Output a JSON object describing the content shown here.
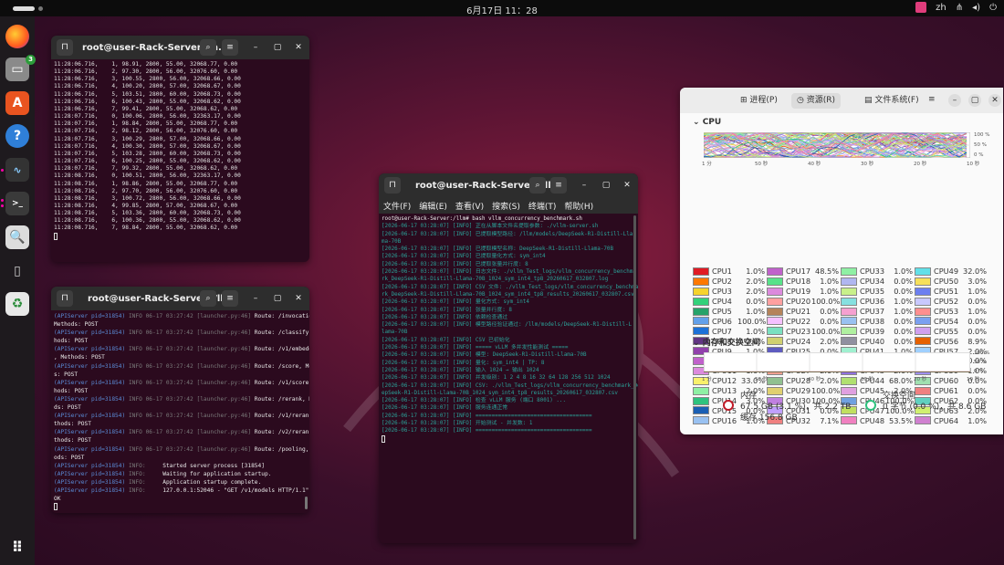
{
  "topbar": {
    "clock": "6月17日  11：28",
    "lang": "zh"
  },
  "dock": {
    "items": [
      {
        "name": "firefox"
      },
      {
        "name": "files",
        "badge": "3"
      },
      {
        "name": "app-center"
      },
      {
        "name": "help"
      },
      {
        "name": "system-monitor"
      },
      {
        "name": "terminal"
      },
      {
        "name": "image-viewer"
      },
      {
        "name": "usb-drive"
      },
      {
        "name": "trash"
      },
      {
        "name": "show-apps"
      }
    ]
  },
  "win1": {
    "title": "root@user-Rack-Server: /h...",
    "lines": [
      "11:28:06.716,    1, 98.91, 2800, 55.00, 32068.77, 0.00",
      "11:28:06.716,    2, 97.30, 2800, 56.00, 32076.60, 0.00",
      "11:28:06.716,    3, 100.55, 2800, 56.00, 32068.66, 0.00",
      "11:28:06.716,    4, 100.20, 2800, 57.00, 32068.67, 0.00",
      "11:28:06.716,    5, 103.51, 2800, 60.00, 32068.73, 0.00",
      "11:28:06.716,    6, 100.43, 2800, 55.00, 32068.62, 0.00",
      "11:28:06.716,    7, 99.41, 2800, 55.00, 32068.62, 0.00",
      "11:28:07.716,    0, 100.06, 2800, 56.00, 32363.17, 0.00",
      "11:28:07.716,    1, 98.84, 2800, 55.00, 32068.77, 0.00",
      "11:28:07.716,    2, 98.12, 2800, 56.00, 32076.60, 0.00",
      "11:28:07.716,    3, 100.29, 2800, 57.00, 32068.66, 0.00",
      "11:28:07.716,    4, 100.30, 2800, 57.00, 32068.67, 0.00",
      "11:28:07.716,    5, 103.28, 2800, 60.00, 32068.73, 0.00",
      "11:28:07.716,    6, 100.25, 2800, 55.00, 32068.62, 0.00",
      "11:28:07.716,    7, 99.32, 2800, 55.00, 32068.62, 0.00",
      "11:28:08.716,    0, 100.51, 2800, 56.00, 32363.17, 0.00",
      "11:28:08.716,    1, 98.86, 2800, 55.00, 32068.77, 0.00",
      "11:28:08.716,    2, 97.70, 2800, 56.00, 32076.60, 0.00",
      "11:28:08.716,    3, 100.72, 2800, 56.00, 32068.66, 0.00",
      "11:28:08.716,    4, 99.85, 2800, 57.00, 32068.67, 0.00",
      "11:28:08.716,    5, 103.36, 2800, 60.00, 32068.73, 0.00",
      "11:28:08.716,    6, 100.36, 2800, 55.00, 32068.62, 0.00",
      "11:28:08.716,    7, 98.84, 2800, 55.00, 32068.62, 0.00"
    ]
  },
  "win2": {
    "title": "root@user-Rack-Server: /llm",
    "log": [
      {
        "p": "(APIServer pid=31854)",
        "m": " INFO 06-17 03:27:42 [launcher.py:46]",
        "t": " Route: /invocations,"
      },
      {
        "p": "",
        "m": "",
        "t": "Methods: POST"
      },
      {
        "p": "(APIServer pid=31854)",
        "m": " INFO 06-17 03:27:42 [launcher.py:46]",
        "t": " Route: /classify, Met"
      },
      {
        "p": "",
        "m": "",
        "t": "hods: POST"
      },
      {
        "p": "(APIServer pid=31854)",
        "m": " INFO 06-17 03:27:42 [launcher.py:46]",
        "t": " Route: /v1/embeddings"
      },
      {
        "p": "",
        "m": "",
        "t": ", Methods: POST"
      },
      {
        "p": "(APIServer pid=31854)",
        "m": " INFO 06-17 03:27:42 [launcher.py:46]",
        "t": " Route: /score, Method"
      },
      {
        "p": "",
        "m": "",
        "t": "s: POST"
      },
      {
        "p": "(APIServer pid=31854)",
        "m": " INFO 06-17 03:27:42 [launcher.py:46]",
        "t": " Route: /v1/score, Met"
      },
      {
        "p": "",
        "m": "",
        "t": "hods: POST"
      },
      {
        "p": "(APIServer pid=31854)",
        "m": " INFO 06-17 03:27:42 [launcher.py:46]",
        "t": " Route: /rerank, Metho"
      },
      {
        "p": "",
        "m": "",
        "t": "ds: POST"
      },
      {
        "p": "(APIServer pid=31854)",
        "m": " INFO 06-17 03:27:42 [launcher.py:46]",
        "t": " Route: /v1/rerank, Me"
      },
      {
        "p": "",
        "m": "",
        "t": "thods: POST"
      },
      {
        "p": "(APIServer pid=31854)",
        "m": " INFO 06-17 03:27:42 [launcher.py:46]",
        "t": " Route: /v2/rerank, Me"
      },
      {
        "p": "",
        "m": "",
        "t": "thods: POST"
      },
      {
        "p": "(APIServer pid=31854)",
        "m": " INFO 06-17 03:27:42 [launcher.py:46]",
        "t": " Route: /pooling, Meth"
      },
      {
        "p": "",
        "m": "",
        "t": "ods: POST"
      },
      {
        "p": "(APIServer pid=31854)",
        "m": " INFO:",
        "t": "     Started server process [31854]"
      },
      {
        "p": "(APIServer pid=31854)",
        "m": " INFO:",
        "t": "     Waiting for application startup."
      },
      {
        "p": "(APIServer pid=31854)",
        "m": " INFO:",
        "t": "     Application startup complete."
      },
      {
        "p": "(APIServer pid=31854)",
        "m": " INFO:",
        "t": "     127.0.0.1:52046 - \"GET /v1/models HTTP/1.1\" 200"
      },
      {
        "p": "",
        "m": "",
        "t": "OK"
      }
    ]
  },
  "win3": {
    "title": "root@user-Rack-Server: /llm",
    "menu": [
      "文件(F)",
      "编辑(E)",
      "查看(V)",
      "搜索(S)",
      "终端(T)",
      "帮助(H)"
    ],
    "cmd": "root@user-Rack-Server:/llm# bash vllm_concurrency_benchmark.sh",
    "lines": [
      "[2026-06-17 03:28:07] [INFO] 正在从脚本文件名提取参数: ./vllm-server.sh",
      "[2026-06-17 03:28:07] [INFO] 已提取模型路径: /llm/models/DeepSeek-R1-Distill-Lla",
      "ma-70B",
      "[2026-06-17 03:28:07] [INFO] 已提取模型名称: DeepSeek-R1-Distill-Llama-70B",
      "[2026-06-17 03:28:07] [INFO] 已提取量化方式: sym_int4",
      "[2026-06-17 03:28:07] [INFO] 已提取张量并行度: 8",
      "[2026-06-17 03:28:07] [INFO] 日志文件: ./vllm_Test_logs/vllm_concurrency_benchma",
      "rk_DeepSeek-R1-Distill-Llama-70B_1024_sym_int4_tp8_20260617_032807.log",
      "[2026-06-17 03:28:07] [INFO] CSV 文件: ./vllm_Test_logs/vllm_concurrency_benchma",
      "rk_DeepSeek-R1-Distill-Llama-70B_1024_sym_int4_tp8_results_20260617_032807.csv",
      "[2026-06-17 03:28:07] [INFO] 量化方式: sym_int4",
      "[2026-06-17 03:28:07] [INFO] 张量并行度: 8",
      "[2026-06-17 03:28:07] [INFO] 依赖检查通过",
      "[2026-06-17 03:28:07] [INFO] 模型路径验证通过: /llm/models/DeepSeek-R1-Distill-L",
      "lama-70B",
      "[2026-06-17 03:28:07] [INFO] CSV 已初始化",
      "[2026-06-17 03:28:07] [INFO] ===== vLLM 多并发性能测试 =====",
      "[2026-06-17 03:28:07] [INFO] 模型: DeepSeek-R1-Distill-Llama-70B",
      "[2026-06-17 03:28:07] [INFO] 量化: sym_int4 | TP: 8",
      "[2026-06-17 03:28:07] [INFO] 输入 1024 → 输出 1024",
      "[2026-06-17 03:28:07] [INFO] 并发级别: 1 2 4 8 16 32 64 128 256 512 1024",
      "[2026-06-17 03:28:07] [INFO] CSV: ./vllm_Test_logs/vllm_concurrency_benchmark_De",
      "epSeek-R1-Distill-Llama-70B_1024_sym_int4_tp8_results_20260617_032807.csv",
      "[2026-06-17 03:28:07] [INFO] 检查 vLLM 服务 (端口 8001) ...",
      "[2026-06-17 03:28:07] [INFO] 服务连通正常",
      "[2026-06-17 03:28:07] [INFO] ====================================",
      "[2026-06-17 03:28:07] [INFO] 开始测试 - 并发数: 1",
      "[2026-06-17 03:28:07] [INFO] ===================================="
    ]
  },
  "sysmon": {
    "tabs": [
      "进程(P)",
      "资源(R)",
      "文件系统(F)"
    ],
    "cpu_title": "CPU",
    "mem_title": "内存和交换空间",
    "ticks_x": [
      "1 分",
      "50 秒",
      "40 秒",
      "30 秒",
      "20 秒",
      "10 秒"
    ],
    "ticks_y": [
      "100 %",
      "50 %",
      "0 %"
    ],
    "cpus": [
      {
        "n": "CPU1",
        "v": "1.0%",
        "c": "#e01b24"
      },
      {
        "n": "CPU17",
        "v": "48.5%",
        "c": "#c061cb"
      },
      {
        "n": "CPU33",
        "v": "1.0%",
        "c": "#8ff0a4"
      },
      {
        "n": "CPU49",
        "v": "32.0%",
        "c": "#62e0e8"
      },
      {
        "n": "CPU2",
        "v": "2.0%",
        "c": "#ff7800"
      },
      {
        "n": "CPU18",
        "v": "1.0%",
        "c": "#57e389"
      },
      {
        "n": "CPU34",
        "v": "0.0%",
        "c": "#b0b6f0"
      },
      {
        "n": "CPU50",
        "v": "3.0%",
        "c": "#f6e05a"
      },
      {
        "n": "CPU3",
        "v": "2.0%",
        "c": "#f6d32d"
      },
      {
        "n": "CPU19",
        "v": "1.0%",
        "c": "#dc8add"
      },
      {
        "n": "CPU35",
        "v": "0.0%",
        "c": "#c8f08a"
      },
      {
        "n": "CPU51",
        "v": "1.0%",
        "c": "#6c7ff0"
      },
      {
        "n": "CPU4",
        "v": "0.0%",
        "c": "#33d17a"
      },
      {
        "n": "CPU20",
        "v": "100.0%",
        "c": "#ffa0a0"
      },
      {
        "n": "CPU36",
        "v": "1.0%",
        "c": "#86e0e0"
      },
      {
        "n": "CPU52",
        "v": "0.0%",
        "c": "#c8c8ff"
      },
      {
        "n": "CPU5",
        "v": "1.0%",
        "c": "#26a269"
      },
      {
        "n": "CPU21",
        "v": "0.0%",
        "c": "#b5835a"
      },
      {
        "n": "CPU37",
        "v": "1.0%",
        "c": "#f5a0d0"
      },
      {
        "n": "CPU53",
        "v": "1.0%",
        "c": "#ff8f8f"
      },
      {
        "n": "CPU6",
        "v": "100.0%",
        "c": "#62a0ea"
      },
      {
        "n": "CPU22",
        "v": "0.0%",
        "c": "#f5c0ff"
      },
      {
        "n": "CPU38",
        "v": "0.0%",
        "c": "#99c1f1"
      },
      {
        "n": "CPU54",
        "v": "0.0%",
        "c": "#7aa0f0"
      },
      {
        "n": "CPU7",
        "v": "1.0%",
        "c": "#1c71d8"
      },
      {
        "n": "CPU23",
        "v": "100.0%",
        "c": "#7ae0c0"
      },
      {
        "n": "CPU39",
        "v": "0.0%",
        "c": "#b0f0a0"
      },
      {
        "n": "CPU55",
        "v": "0.0%",
        "c": "#d0a0f0"
      },
      {
        "n": "CPU8",
        "v": "2.0%",
        "c": "#613583"
      },
      {
        "n": "CPU24",
        "v": "2.0%",
        "c": "#d0d070"
      },
      {
        "n": "CPU40",
        "v": "0.0%",
        "c": "#9090a0"
      },
      {
        "n": "CPU56",
        "v": "8.9%",
        "c": "#e66100"
      },
      {
        "n": "CPU9",
        "v": "1.0%",
        "c": "#9141ac"
      },
      {
        "n": "CPU25",
        "v": "0.0%",
        "c": "#5e5cc0"
      },
      {
        "n": "CPU41",
        "v": "1.0%",
        "c": "#a0f0d0"
      },
      {
        "n": "CPU57",
        "v": "2.0%",
        "c": "#a0d0ff"
      },
      {
        "n": "CPU10",
        "v": "1.0%",
        "c": "#c061cb"
      },
      {
        "n": "CPU26",
        "v": "0.0%",
        "c": "#a0c080"
      },
      {
        "n": "CPU42",
        "v": "2.0%",
        "c": "#e090c0"
      },
      {
        "n": "CPU58",
        "v": "0.0%",
        "c": "#f0b070"
      },
      {
        "n": "CPU11",
        "v": "1.0%",
        "c": "#dc8add"
      },
      {
        "n": "CPU27",
        "v": "2.0%",
        "c": "#f0a090"
      },
      {
        "n": "CPU43",
        "v": "2.0%",
        "c": "#9070e0"
      },
      {
        "n": "CPU59",
        "v": "1.0%",
        "c": "#a090f0"
      },
      {
        "n": "CPU12",
        "v": "33.0%",
        "c": "#f9f06b"
      },
      {
        "n": "CPU28",
        "v": "2.0%",
        "c": "#90c090"
      },
      {
        "n": "CPU44",
        "v": "68.0%",
        "c": "#b0e070"
      },
      {
        "n": "CPU60",
        "v": "0.0%",
        "c": "#a0e0b0"
      },
      {
        "n": "CPU13",
        "v": "2.0%",
        "c": "#8ff0a4"
      },
      {
        "n": "CPU29",
        "v": "100.0%",
        "c": "#e0d070"
      },
      {
        "n": "CPU45",
        "v": "2.0%",
        "c": "#e0a0e0"
      },
      {
        "n": "CPU61",
        "v": "0.0%",
        "c": "#f08080"
      },
      {
        "n": "CPU14",
        "v": "3.0%",
        "c": "#2ec27e"
      },
      {
        "n": "CPU30",
        "v": "100.0%",
        "c": "#c080e0"
      },
      {
        "n": "CPU46",
        "v": "100.0%",
        "c": "#70a0e0"
      },
      {
        "n": "CPU62",
        "v": "0.0%",
        "c": "#60d0c0"
      },
      {
        "n": "CPU15",
        "v": "0.0%",
        "c": "#1a5fb4"
      },
      {
        "n": "CPU31",
        "v": "0.0%",
        "c": "#c0a0ff"
      },
      {
        "n": "CPU47",
        "v": "100.0%",
        "c": "#c0e060"
      },
      {
        "n": "CPU63",
        "v": "2.0%",
        "c": "#d0f070"
      },
      {
        "n": "CPU16",
        "v": "1.0%",
        "c": "#99c1f1"
      },
      {
        "n": "CPU32",
        "v": "7.1%",
        "c": "#f08080"
      },
      {
        "n": "CPU48",
        "v": "53.5%",
        "c": "#f080c0"
      },
      {
        "n": "CPU64",
        "v": "1.0%",
        "c": "#d080d0"
      }
    ],
    "mem": {
      "label": "内存",
      "used": "67.5 GB (3.1 %)，共 2.2 TB",
      "cache": "缓存 156.8 GB"
    },
    "swap": {
      "label": "交换空间",
      "used": "0 字节 (0.0 %)，共 8.6 GB"
    }
  }
}
